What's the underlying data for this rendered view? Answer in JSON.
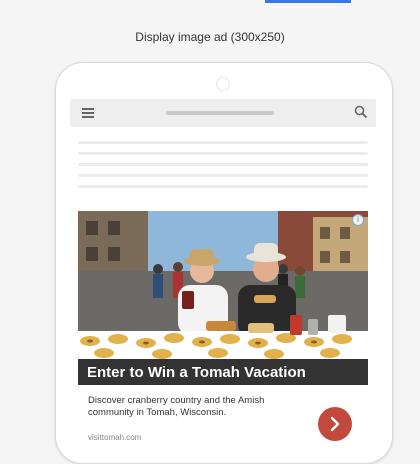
{
  "preview": {
    "title": "Display image ad (300x250)"
  },
  "ad": {
    "headline": "Enter to Win a Tomah Vacation",
    "description": "Discover cranberry country and the Amish community in Tomah, Wisconsin.",
    "display_url": "visittomah.com",
    "ad_choices_glyph": "i"
  },
  "icons": {
    "menu": "menu-icon",
    "search": "search-icon",
    "cta": "chevron-right-icon"
  },
  "colors": {
    "accent_indicator": "#3b78e7",
    "cta_button": "#c14a3c",
    "headline_background": "#222222"
  }
}
